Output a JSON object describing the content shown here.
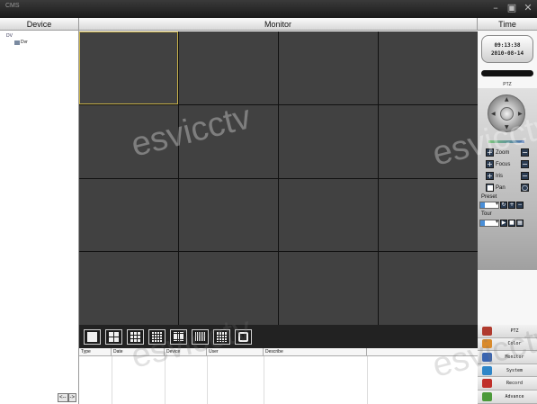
{
  "window": {
    "title": "CMS",
    "controls": [
      "–",
      "▣",
      "✕"
    ]
  },
  "headers": {
    "device": "Device",
    "monitor": "Monitor",
    "time": "Time"
  },
  "device_tree": {
    "root": "DV",
    "child": "Dvr"
  },
  "device_nav": {
    "prev": "<--",
    "next": "->"
  },
  "clock": {
    "time": "09:13:38",
    "date": "2010-08-14"
  },
  "ptz": {
    "label": "PTZ",
    "zoom": "Zoom",
    "focus": "Focus",
    "iris": "Iris",
    "pan": "Pan",
    "preset": "Preset",
    "tour": "Tour"
  },
  "log_table": {
    "columns": [
      "Type",
      "Date",
      "Device",
      "User",
      "Describe"
    ]
  },
  "layout_buttons": [
    {
      "name": "layout-1-button",
      "grid": 1
    },
    {
      "name": "layout-4-button",
      "grid": 2
    },
    {
      "name": "layout-9-button",
      "grid": 3
    },
    {
      "name": "layout-16-button",
      "grid": 4
    },
    {
      "name": "layout-25-button",
      "grid": 5
    },
    {
      "name": "layout-36-button",
      "grid": 6
    },
    {
      "name": "layout-64-button",
      "grid": 8
    },
    {
      "name": "fullscreen-button",
      "grid": 0
    }
  ],
  "function_menu": [
    {
      "label": "PTZ",
      "color": "#b03a2e"
    },
    {
      "label": "Color",
      "color": "#d98a2b"
    },
    {
      "label": "Monitor",
      "color": "#3a64b0"
    },
    {
      "label": "System",
      "color": "#2f86c8"
    },
    {
      "label": "Record",
      "color": "#c0302a"
    },
    {
      "label": "Advance",
      "color": "#4c9a3a"
    }
  ],
  "watermark": "esvicctv",
  "colors": {
    "title_bar": "#1a1a1a",
    "video_cell": "#414141",
    "selected_cell": "#c9b24a"
  }
}
